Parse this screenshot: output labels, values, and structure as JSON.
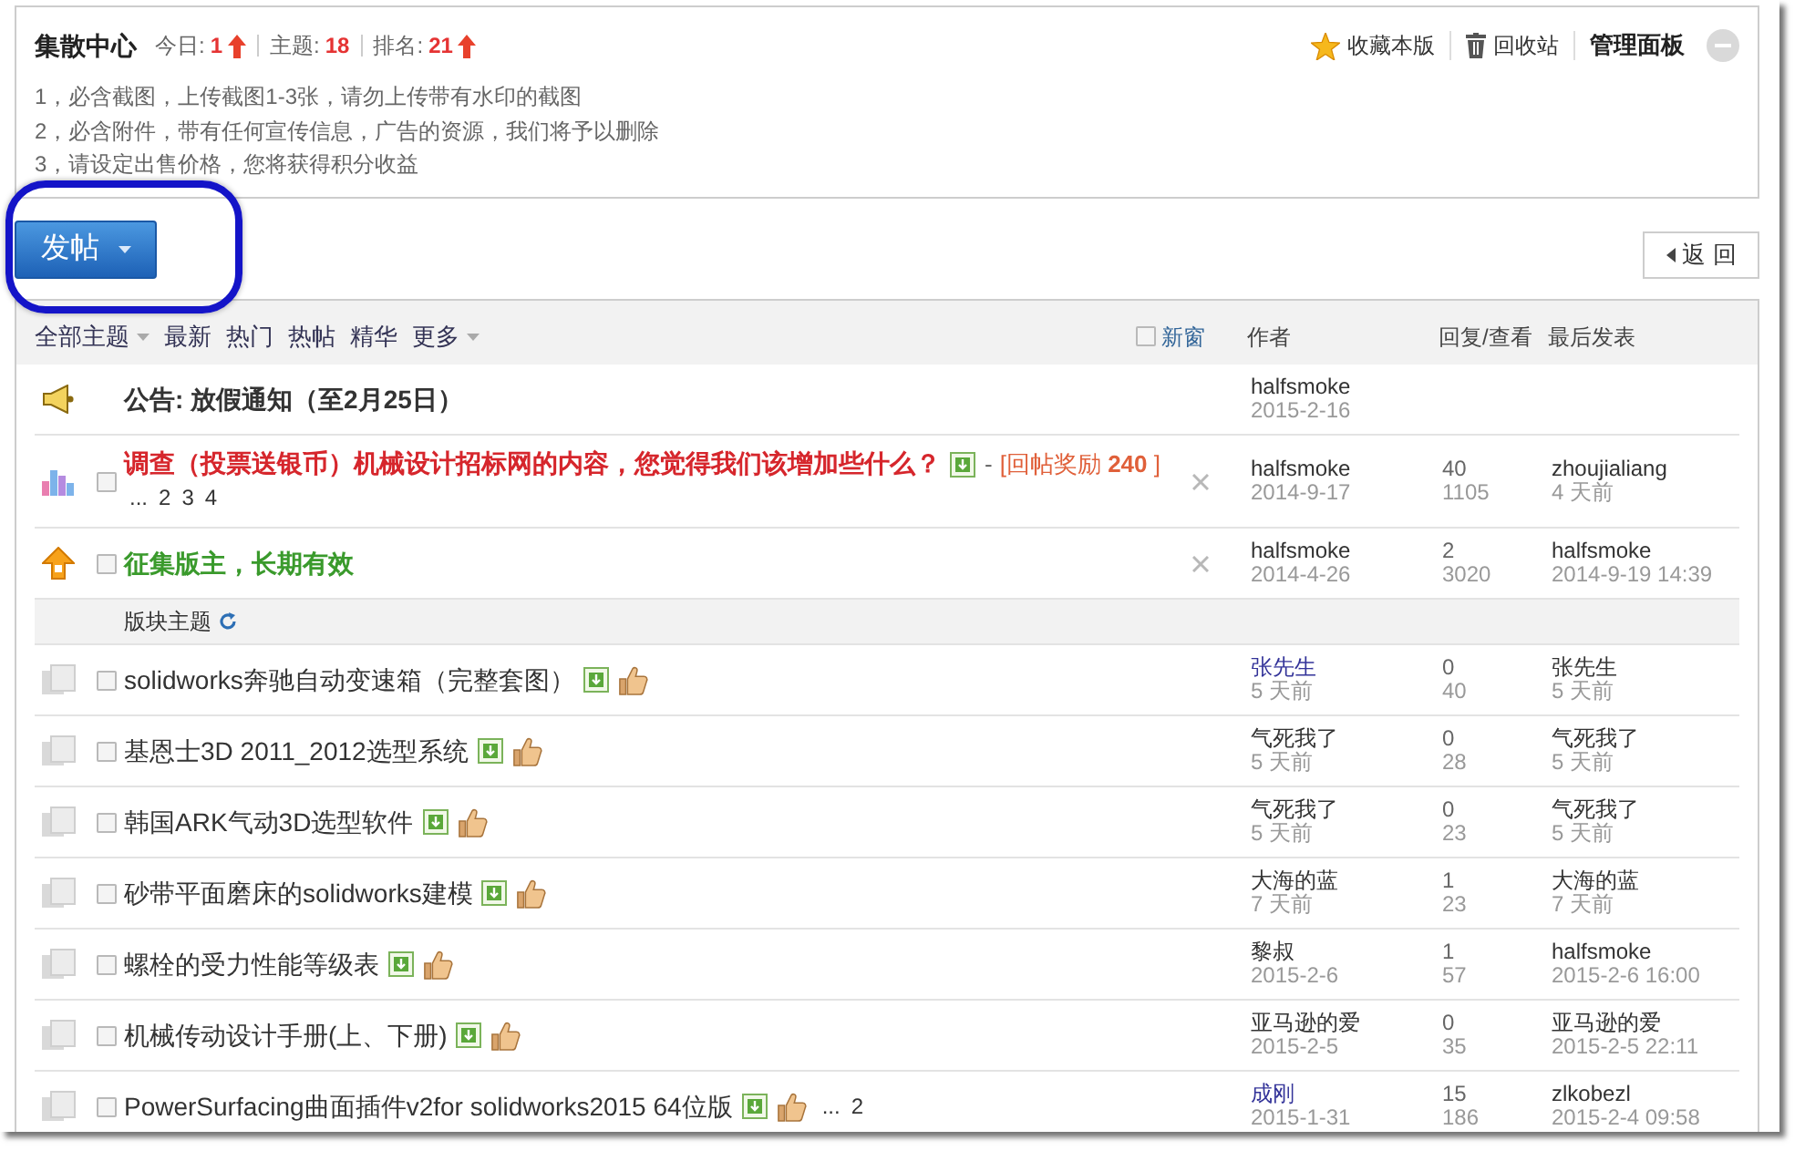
{
  "forum_header": {
    "title": "集散中心",
    "stats": [
      {
        "label": "今日:",
        "value": "1",
        "rising": true
      },
      {
        "label": "主题:",
        "value": "18",
        "rising": false
      },
      {
        "label": "排名:",
        "value": "21",
        "rising": true
      }
    ],
    "actions": [
      {
        "kind": "favorite",
        "label": "收藏本版"
      },
      {
        "kind": "recycle_bin",
        "label": "回收站"
      },
      {
        "kind": "admin_panel",
        "label": "管理面板"
      }
    ],
    "rules": [
      "1，必含截图，上传截图1-3张，请勿上传带有水印的截图",
      "2，必含附件，带有任何宣传信息，广告的资源，我们将予以删除",
      "3，请设定出售价格，您将获得积分收益"
    ]
  },
  "post_button": {
    "label": "发帖"
  },
  "back_button": {
    "label": "返 回"
  },
  "thread_list": {
    "filters": [
      {
        "label": "全部主题",
        "dropdown": true
      },
      {
        "label": "最新",
        "dropdown": false
      },
      {
        "label": "热门",
        "dropdown": false
      },
      {
        "label": "热帖",
        "dropdown": false
      },
      {
        "label": "精华",
        "dropdown": false
      },
      {
        "label": "更多",
        "dropdown": true
      }
    ],
    "new_window": {
      "label": "新窗",
      "checked": false
    },
    "columns": [
      "作者",
      "回复/查看",
      "最后发表"
    ],
    "sticky_threads": [
      {
        "kind": "announcement",
        "title": "公告: 放假通知（至2月25日）",
        "color": "#333333",
        "bold": true,
        "attachment": false,
        "recommended": false,
        "closable": false,
        "author": {
          "name": "halfsmoke",
          "date": "2015-2-16",
          "color": "#333333"
        }
      },
      {
        "kind": "poll",
        "checked": false,
        "title": "调查（投票送银币）机械设计招标网的内容，您觉得我们该增加些什么？",
        "color": "#d6262c",
        "bold": true,
        "attachment": true,
        "recommended": false,
        "reward": {
          "separator": "-",
          "text": "[回帖奖励 **240** ]"
        },
        "pages": {
          "ellipsis": "...",
          "links": [
            "2",
            "3",
            "4"
          ]
        },
        "closable": true,
        "author": {
          "name": "halfsmoke",
          "date": "2014-9-17",
          "color": "#333333"
        },
        "replies": "40",
        "views": "1105",
        "last_post": {
          "name": "zhoujialiang",
          "time": "4 天前"
        }
      },
      {
        "kind": "sticky",
        "checked": false,
        "title": "征集版主，长期有效",
        "color": "#3a9a2c",
        "bold": true,
        "attachment": false,
        "recommended": false,
        "closable": true,
        "author": {
          "name": "halfsmoke",
          "date": "2014-4-26",
          "color": "#333333"
        },
        "replies": "2",
        "views": "3020",
        "last_post": {
          "name": "halfsmoke",
          "time": "2014-9-19 14:39"
        }
      }
    ],
    "section_label": "版块主题",
    "threads": [
      {
        "kind": "normal",
        "checked": false,
        "title": "solidworks奔驰自动变速箱（完整套图）",
        "color": "#333333",
        "bold": false,
        "attachment": true,
        "recommended": true,
        "closable": false,
        "author": {
          "name": "张先生",
          "date": "5 天前",
          "color": "#333399"
        },
        "replies": "0",
        "views": "40",
        "last_post": {
          "name": "张先生",
          "time": "5 天前"
        }
      },
      {
        "kind": "normal",
        "checked": false,
        "title": "基恩士3D 2011_2012选型系统",
        "color": "#333333",
        "bold": false,
        "attachment": true,
        "recommended": true,
        "closable": false,
        "author": {
          "name": "气死我了",
          "date": "5 天前",
          "color": "#333333"
        },
        "replies": "0",
        "views": "28",
        "last_post": {
          "name": "气死我了",
          "time": "5 天前"
        }
      },
      {
        "kind": "normal",
        "checked": false,
        "title": "韩国ARK气动3D选型软件",
        "color": "#333333",
        "bold": false,
        "attachment": true,
        "recommended": true,
        "closable": false,
        "author": {
          "name": "气死我了",
          "date": "5 天前",
          "color": "#333333"
        },
        "replies": "0",
        "views": "23",
        "last_post": {
          "name": "气死我了",
          "time": "5 天前"
        }
      },
      {
        "kind": "normal",
        "checked": false,
        "title": "砂带平面磨床的solidworks建模",
        "color": "#333333",
        "bold": false,
        "attachment": true,
        "recommended": true,
        "closable": false,
        "author": {
          "name": "大海的蓝",
          "date": "7 天前",
          "color": "#333333"
        },
        "replies": "1",
        "views": "23",
        "last_post": {
          "name": "大海的蓝",
          "time": "7 天前"
        }
      },
      {
        "kind": "normal",
        "checked": false,
        "title": "螺栓的受力性能等级表",
        "color": "#333333",
        "bold": false,
        "attachment": true,
        "recommended": true,
        "closable": false,
        "author": {
          "name": "黎叔",
          "date": "2015-2-6",
          "color": "#333333"
        },
        "replies": "1",
        "views": "57",
        "last_post": {
          "name": "halfsmoke",
          "time": "2015-2-6 16:00"
        }
      },
      {
        "kind": "normal",
        "checked": false,
        "title": "机械传动设计手册(上、下册)",
        "color": "#333333",
        "bold": false,
        "attachment": true,
        "recommended": true,
        "closable": false,
        "author": {
          "name": "亚马逊的爱",
          "date": "2015-2-5",
          "color": "#333333"
        },
        "replies": "0",
        "views": "35",
        "last_post": {
          "name": "亚马逊的爱",
          "time": "2015-2-5 22:11"
        }
      },
      {
        "kind": "normal",
        "checked": false,
        "title": "PowerSurfacing曲面插件v2for solidworks2015 64位版",
        "color": "#333333",
        "bold": false,
        "attachment": true,
        "recommended": true,
        "pages": {
          "ellipsis": "...",
          "links": [
            "2"
          ]
        },
        "closable": false,
        "author": {
          "name": "成刚",
          "date": "2015-1-31",
          "color": "#333399"
        },
        "replies": "15",
        "views": "186",
        "last_post": {
          "name": "zlkobezl",
          "time": "2015-2-4 09:58"
        }
      }
    ]
  }
}
